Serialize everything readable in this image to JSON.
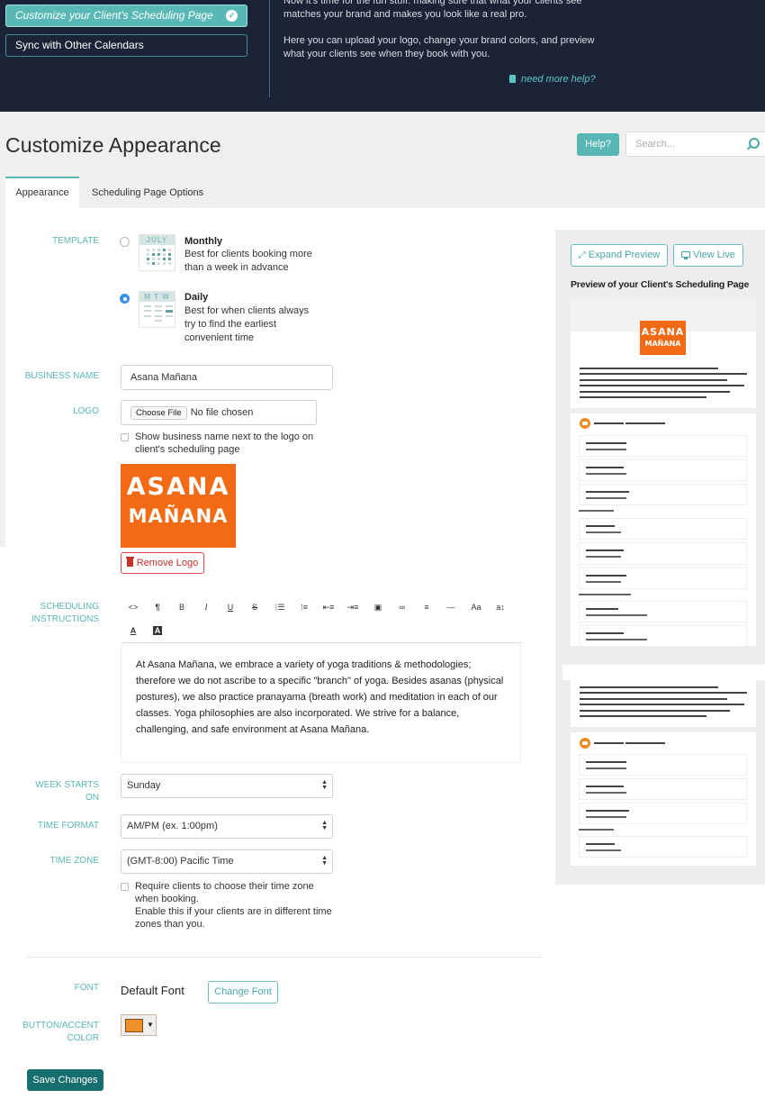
{
  "banner": {
    "steps": [
      {
        "label": "Customize your Client's Scheduling Page",
        "state": "active",
        "icon": "check-circle-icon"
      },
      {
        "label": "Sync with Other Calendars",
        "state": "inactive"
      }
    ],
    "paragraph1": "Now it's time for the fun stuff: making sure that what your clients see matches your brand and makes you look like a real pro.",
    "paragraph2": "Here you can upload your logo, change your brand colors, and preview what your clients see when they book with you.",
    "help_link": "need more help?"
  },
  "header": {
    "title": "Customize Appearance",
    "help_button": "Help?",
    "search_placeholder": "Search..."
  },
  "tabs": [
    {
      "label": "Appearance",
      "active": true
    },
    {
      "label": "Scheduling Page Options",
      "active": false
    }
  ],
  "form": {
    "template": {
      "label": "Template",
      "options": [
        {
          "title": "Monthly",
          "description": "Best for clients booking more than a week in advance",
          "icon_header": "JULY",
          "selected": false
        },
        {
          "title": "Daily",
          "description": "Best for when clients always try to find the earliest convenient time",
          "icon_header": "M T W",
          "selected": true
        }
      ]
    },
    "business_name": {
      "label": "Business Name",
      "value": "Asana Mañana"
    },
    "logo": {
      "label": "Logo",
      "choose_file": "Choose File",
      "file_status": "No file chosen",
      "show_name_checkbox": "Show business name next to the logo on client's scheduling page",
      "show_name_checked": false,
      "logo_line1": "ASANA",
      "logo_line2": "MAÑANA",
      "remove_button": "Remove Logo"
    },
    "scheduling_instructions": {
      "label_line1": "Scheduling",
      "label_line2": "Instructions",
      "toolbar": [
        "<>",
        "¶",
        "B",
        "I",
        "U",
        "S",
        "ul",
        "ol",
        "outdent",
        "indent",
        "image",
        "link",
        "align",
        "hr",
        "Aa",
        "a↕",
        "A",
        "A-bg"
      ],
      "text": "At Asana Mañana, we embrace a variety of yoga traditions & methodologies; therefore we do not ascribe to a specific \"branch\" of yoga. Besides asanas (physical postures), we also practice pranayama (breath work) and meditation in each of our classes. Yoga philosophies are also incorporated. We strive for a balance, challenging, and safe environment at Asana Mañana."
    },
    "week_starts_on": {
      "label_line1": "Week Starts",
      "label_line2": "On",
      "value": "Sunday"
    },
    "time_format": {
      "label": "Time Format",
      "value": "AM/PM (ex. 1:00pm)"
    },
    "time_zone": {
      "label": "Time Zone",
      "value": "(GMT-8:00) Pacific Time",
      "require_checkbox_line1": "Require clients to choose their time zone when booking.",
      "require_checkbox_line2": "Enable this if your clients are in different time zones than you.",
      "require_checked": false
    },
    "font": {
      "label": "Font",
      "value": "Default Font",
      "change_button": "Change Font"
    },
    "accent_color": {
      "label_line1": "Button/Accent",
      "label_line2": "Color",
      "value": "#f0902a"
    },
    "save_button": "Save Changes"
  },
  "preview": {
    "expand_button": "Expand Preview",
    "view_live_button": "View Live",
    "heading": "Preview of your Client's Scheduling Page",
    "logo_line1": "ASANA",
    "logo_line2": "MAÑANA"
  },
  "colors": {
    "accent_teal": "#58b6b5",
    "banner_bg": "#1b2436",
    "logo_orange": "#f26b14",
    "save_button": "#166e6e",
    "remove_red": "#c9302c"
  }
}
